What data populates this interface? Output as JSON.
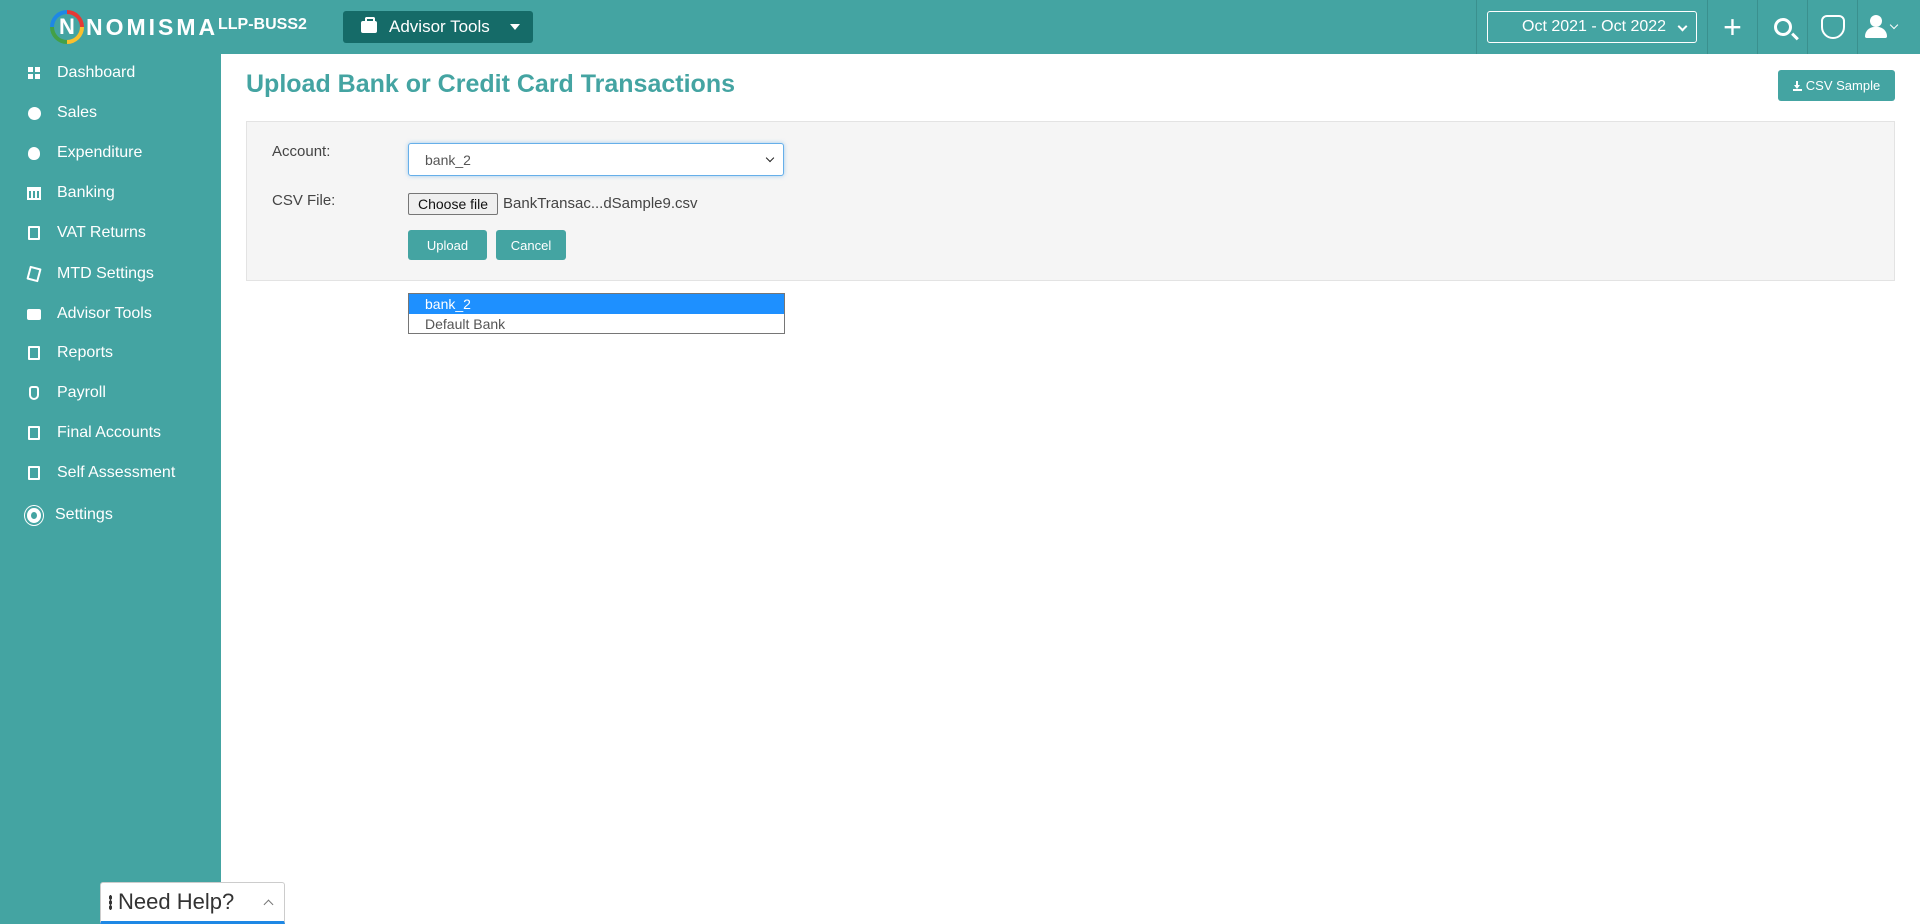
{
  "header": {
    "logo_text": "NOMISMA",
    "logo_letter": "N",
    "company": "LLP-BUSS2",
    "advisor_button": "Advisor Tools",
    "period": "Oct 2021 - Oct 2022",
    "plus": "+"
  },
  "sidebar": {
    "items": [
      {
        "label": "Dashboard",
        "icon": "dashboard-icon"
      },
      {
        "label": "Sales",
        "icon": "sales-icon"
      },
      {
        "label": "Expenditure",
        "icon": "money-bag-icon"
      },
      {
        "label": "Banking",
        "icon": "bank-icon"
      },
      {
        "label": "VAT Returns",
        "icon": "vat-icon"
      },
      {
        "label": "MTD Settings",
        "icon": "mtd-icon"
      },
      {
        "label": "Advisor Tools",
        "icon": "briefcase-icon"
      },
      {
        "label": "Reports",
        "icon": "reports-icon"
      },
      {
        "label": "Payroll",
        "icon": "payroll-icon"
      },
      {
        "label": "Final Accounts",
        "icon": "final-accounts-icon"
      },
      {
        "label": "Self Assessment",
        "icon": "self-assessment-icon"
      },
      {
        "label": "Settings",
        "icon": "gear-icon"
      }
    ]
  },
  "main": {
    "title": "Upload Bank or Credit Card Transactions",
    "csv_sample_label": "CSV Sample",
    "form": {
      "account_label": "Account:",
      "account_value": "bank_2",
      "csv_label": "CSV File:",
      "choose_file_label": "Choose file",
      "file_name": "BankTransac...dSample9.csv",
      "upload_label": "Upload",
      "cancel_label": "Cancel"
    },
    "dropdown_options": [
      "bank_2",
      "Default Bank"
    ]
  },
  "help_widget": {
    "label": "Need Help?"
  },
  "colors": {
    "primary": "#44a4a2",
    "dark_accent": "#156b68",
    "selected_option": "#1e90ff"
  }
}
